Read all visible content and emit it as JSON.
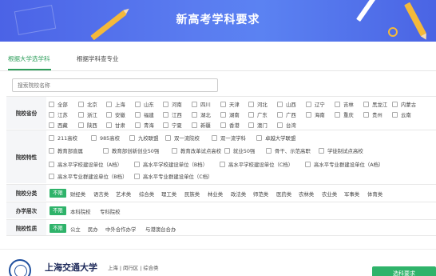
{
  "banner": {
    "title": "新高考学科要求"
  },
  "tabs": [
    {
      "label": "根据大学选学科"
    },
    {
      "label": "根据学科查专业"
    }
  ],
  "search": {
    "placeholder": "搜索院校名称"
  },
  "filters": {
    "province": {
      "label": "院校省份",
      "options": [
        "全部",
        "北京",
        "上海",
        "山东",
        "河南",
        "四川",
        "天津",
        "河北",
        "山西",
        "辽宁",
        "吉林",
        "黑龙江",
        "内蒙古",
        "江苏",
        "浙江",
        "安徽",
        "福建",
        "江西",
        "湖北",
        "湖南",
        "广东",
        "广西",
        "海南",
        "重庆",
        "贵州",
        "云南",
        "西藏",
        "陕西",
        "甘肃",
        "青海",
        "宁夏",
        "新疆",
        "香港",
        "澳门",
        "台湾"
      ]
    },
    "feature": {
      "label": "院校特性",
      "options": [
        "211高校",
        "985高校",
        "九校联盟",
        "双一流院校",
        "双一流学科",
        "卓越大学联盟",
        "教育部直属",
        "教育部创新创业50强",
        "教育改革试点高校",
        "就业50强",
        "骨干、示范高职",
        "学徒制试点高校",
        "高水平学校建设单位（A档）",
        "高水平学校建设单位（B档）",
        "高水平学校建设单位（C档）",
        "高水平专业群建设单位（A档）",
        "高水平专业群建设单位（B档）",
        "高水平专业群建设单位（C档）"
      ]
    },
    "category": {
      "label": "院校分类",
      "selected": "不限",
      "options": [
        "财经类",
        "语言类",
        "艺术类",
        "综合类",
        "理工类",
        "民族类",
        "林业类",
        "政法类",
        "师范类",
        "医药类",
        "农林类",
        "农业类",
        "军事类",
        "体育类"
      ]
    },
    "level": {
      "label": "办学层次",
      "selected": "不限",
      "options": [
        "本科院校",
        "专科院校"
      ]
    },
    "nature": {
      "label": "院校性质",
      "selected": "不限",
      "options": [
        "公立",
        "民办",
        "中外合作办学",
        "与港澳台合办"
      ]
    }
  },
  "university": {
    "name": "上海交通大学",
    "location": "上海 | 闵行区 | 综合类",
    "action_label": "选科要求"
  },
  "colors": {
    "accent": "#2fb36a",
    "banner": "#5178ee",
    "tab_active": "#2e9e5b"
  }
}
